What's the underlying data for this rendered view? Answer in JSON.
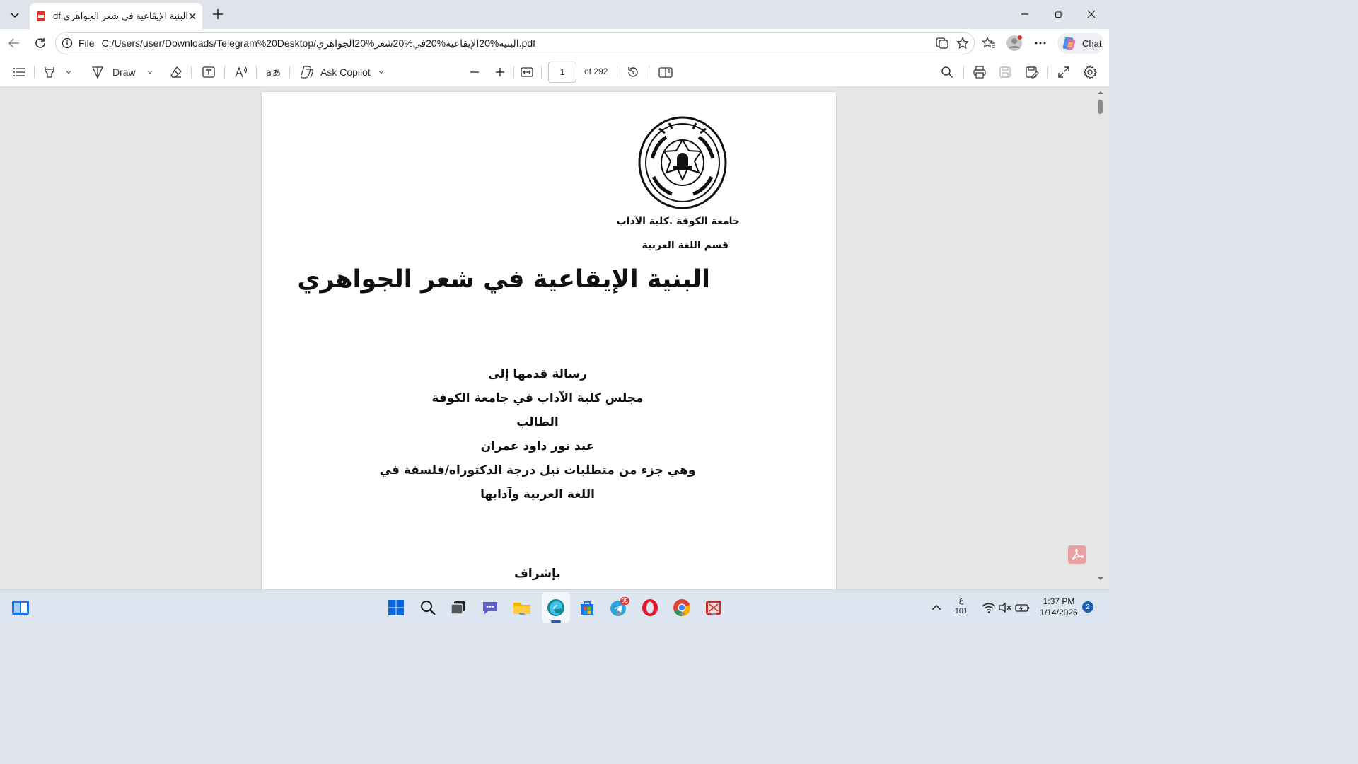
{
  "browser": {
    "tab": {
      "title": "البنية الإيقاعية في شعر الجواهري.pdf"
    },
    "address": {
      "scheme_label": "File",
      "url": "C:/Users/user/Downloads/Telegram%20Desktop/البنية%20الإيقاعية%20في%20شعر%20الجواهري.pdf"
    },
    "chat_label": "Chat"
  },
  "pdf_toolbar": {
    "draw_label": "Draw",
    "ask_copilot_label": "Ask Copilot",
    "page_current": "1",
    "page_total": "of 292"
  },
  "document": {
    "university": "جامعة الكوفة .كلية الآداب",
    "department": "قسم اللغة العربية",
    "title": "البنية الإيقاعية في شعر الجواهري",
    "lines": [
      "رسالة قدمها إلى",
      "مجلس كلية الآداب في جامعة الكوفة",
      "الطالب",
      "عبد نور داود عمران",
      "وهي جزء من متطلبات نيل درجة الدكتوراه/فلسفة في",
      "اللغة العربية وآدابها"
    ],
    "supervision": "بإشراف"
  },
  "taskbar": {
    "telegram_badge": "95",
    "lang_top": "ع",
    "lang_bottom": "101",
    "time": "1:37 PM",
    "date": "1/14/2026",
    "notifications": "2"
  },
  "colors": {
    "accent": "#1a5fb4",
    "pdf_bg": "#e7e7e7",
    "tab_bar": "#dfe3ea"
  }
}
